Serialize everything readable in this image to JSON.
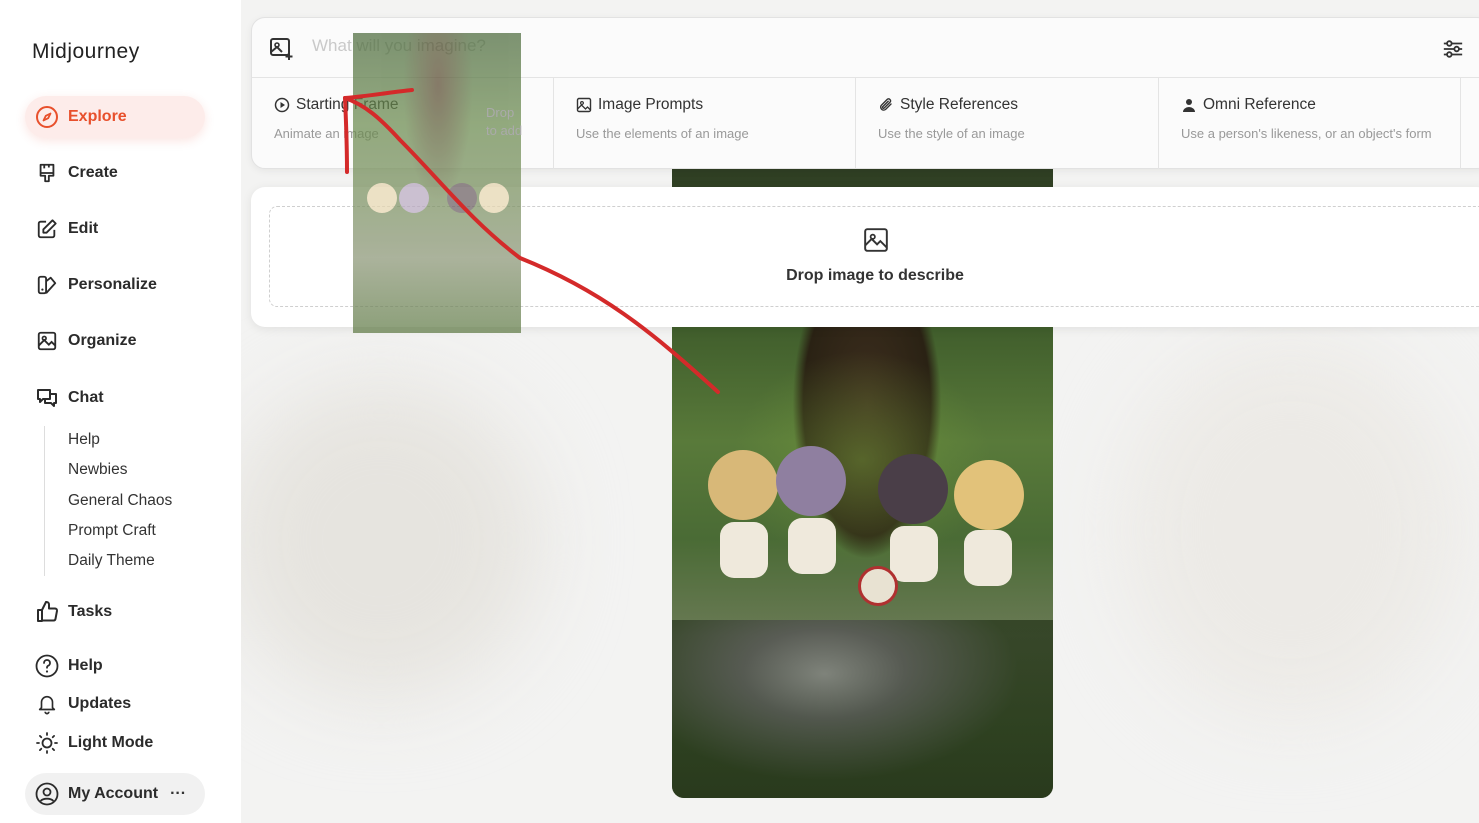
{
  "app": {
    "brand": "Midjourney"
  },
  "sidebar": {
    "items": [
      {
        "label": "Explore",
        "icon": "compass-icon"
      },
      {
        "label": "Create",
        "icon": "brush-icon"
      },
      {
        "label": "Edit",
        "icon": "edit-icon"
      },
      {
        "label": "Personalize",
        "icon": "personalize-icon"
      },
      {
        "label": "Organize",
        "icon": "image-icon"
      },
      {
        "label": "Chat",
        "icon": "chat-icon"
      }
    ],
    "chat_channels": [
      "Help",
      "Newbies",
      "General Chaos",
      "Prompt Craft",
      "Daily Theme"
    ],
    "bottom": [
      {
        "label": "Tasks",
        "icon": "thumbs-up-icon"
      },
      {
        "label": "Help",
        "icon": "help-icon"
      },
      {
        "label": "Updates",
        "icon": "bell-icon"
      },
      {
        "label": "Light Mode",
        "icon": "sun-icon"
      },
      {
        "label": "My Account",
        "icon": "account-icon"
      }
    ],
    "account_more": "···"
  },
  "prompt": {
    "placeholder": "What will you imagine?",
    "options": [
      {
        "title": "Starting Frame",
        "desc": "Animate an image",
        "hint": "Drop to add",
        "icon": "play-icon"
      },
      {
        "title": "Image Prompts",
        "desc": "Use the elements of an image",
        "icon": "image-icon"
      },
      {
        "title": "Style References",
        "desc": "Use the style of an image",
        "icon": "paperclip-icon"
      },
      {
        "title": "Omni Reference",
        "desc": "Use a person's likeness, or an object's form",
        "icon": "person-icon"
      }
    ]
  },
  "describe": {
    "text": "Drop image to describe"
  },
  "colors": {
    "accent": "#e8502c",
    "arrow": "#d42a2a"
  }
}
